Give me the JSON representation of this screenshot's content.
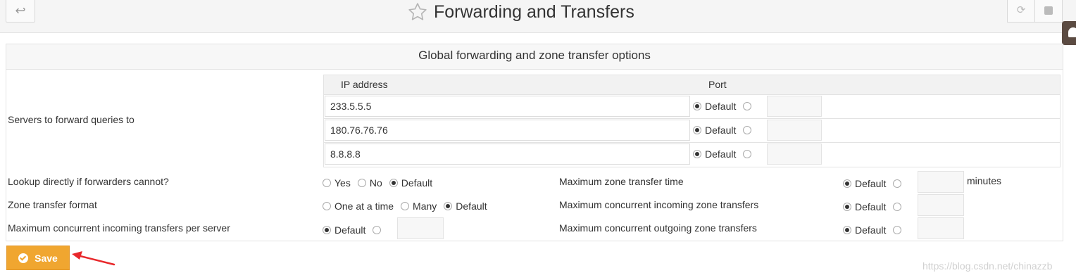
{
  "header": {
    "back_icon": "↩",
    "title": "Forwarding and Transfers",
    "refresh_icon": "⟳"
  },
  "panel": {
    "heading": "Global forwarding and zone transfer options"
  },
  "forwarders": {
    "label": "Servers to forward queries to",
    "col_ip": "IP address",
    "col_port": "Port",
    "rows": [
      {
        "ip": "233.5.5.5",
        "port_mode": "Default"
      },
      {
        "ip": "180.76.76.76",
        "port_mode": "Default"
      },
      {
        "ip": "8.8.8.8",
        "port_mode": "Default"
      }
    ]
  },
  "lookup_direct": {
    "label": "Lookup directly if forwarders cannot?",
    "opt_yes": "Yes",
    "opt_no": "No",
    "opt_default": "Default",
    "selected": "Default"
  },
  "zone_format": {
    "label": "Zone transfer format",
    "opt_one": "One at a time",
    "opt_many": "Many",
    "opt_default": "Default",
    "selected": "Default"
  },
  "max_per_server": {
    "label": "Maximum concurrent incoming transfers per server",
    "opt_default": "Default",
    "selected": "Default"
  },
  "max_time": {
    "label": "Maximum zone transfer time",
    "opt_default": "Default",
    "unit": "minutes",
    "selected": "Default"
  },
  "max_incoming": {
    "label": "Maximum concurrent incoming zone transfers",
    "opt_default": "Default",
    "selected": "Default"
  },
  "max_outgoing": {
    "label": "Maximum concurrent outgoing zone transfers",
    "opt_default": "Default",
    "selected": "Default"
  },
  "actions": {
    "save_label": "Save"
  },
  "watermark": "https://blog.csdn.net/chinazzb",
  "colors": {
    "accent": "#f0a630",
    "arrow": "#e8282b",
    "side_tab": "#5b4b42"
  }
}
